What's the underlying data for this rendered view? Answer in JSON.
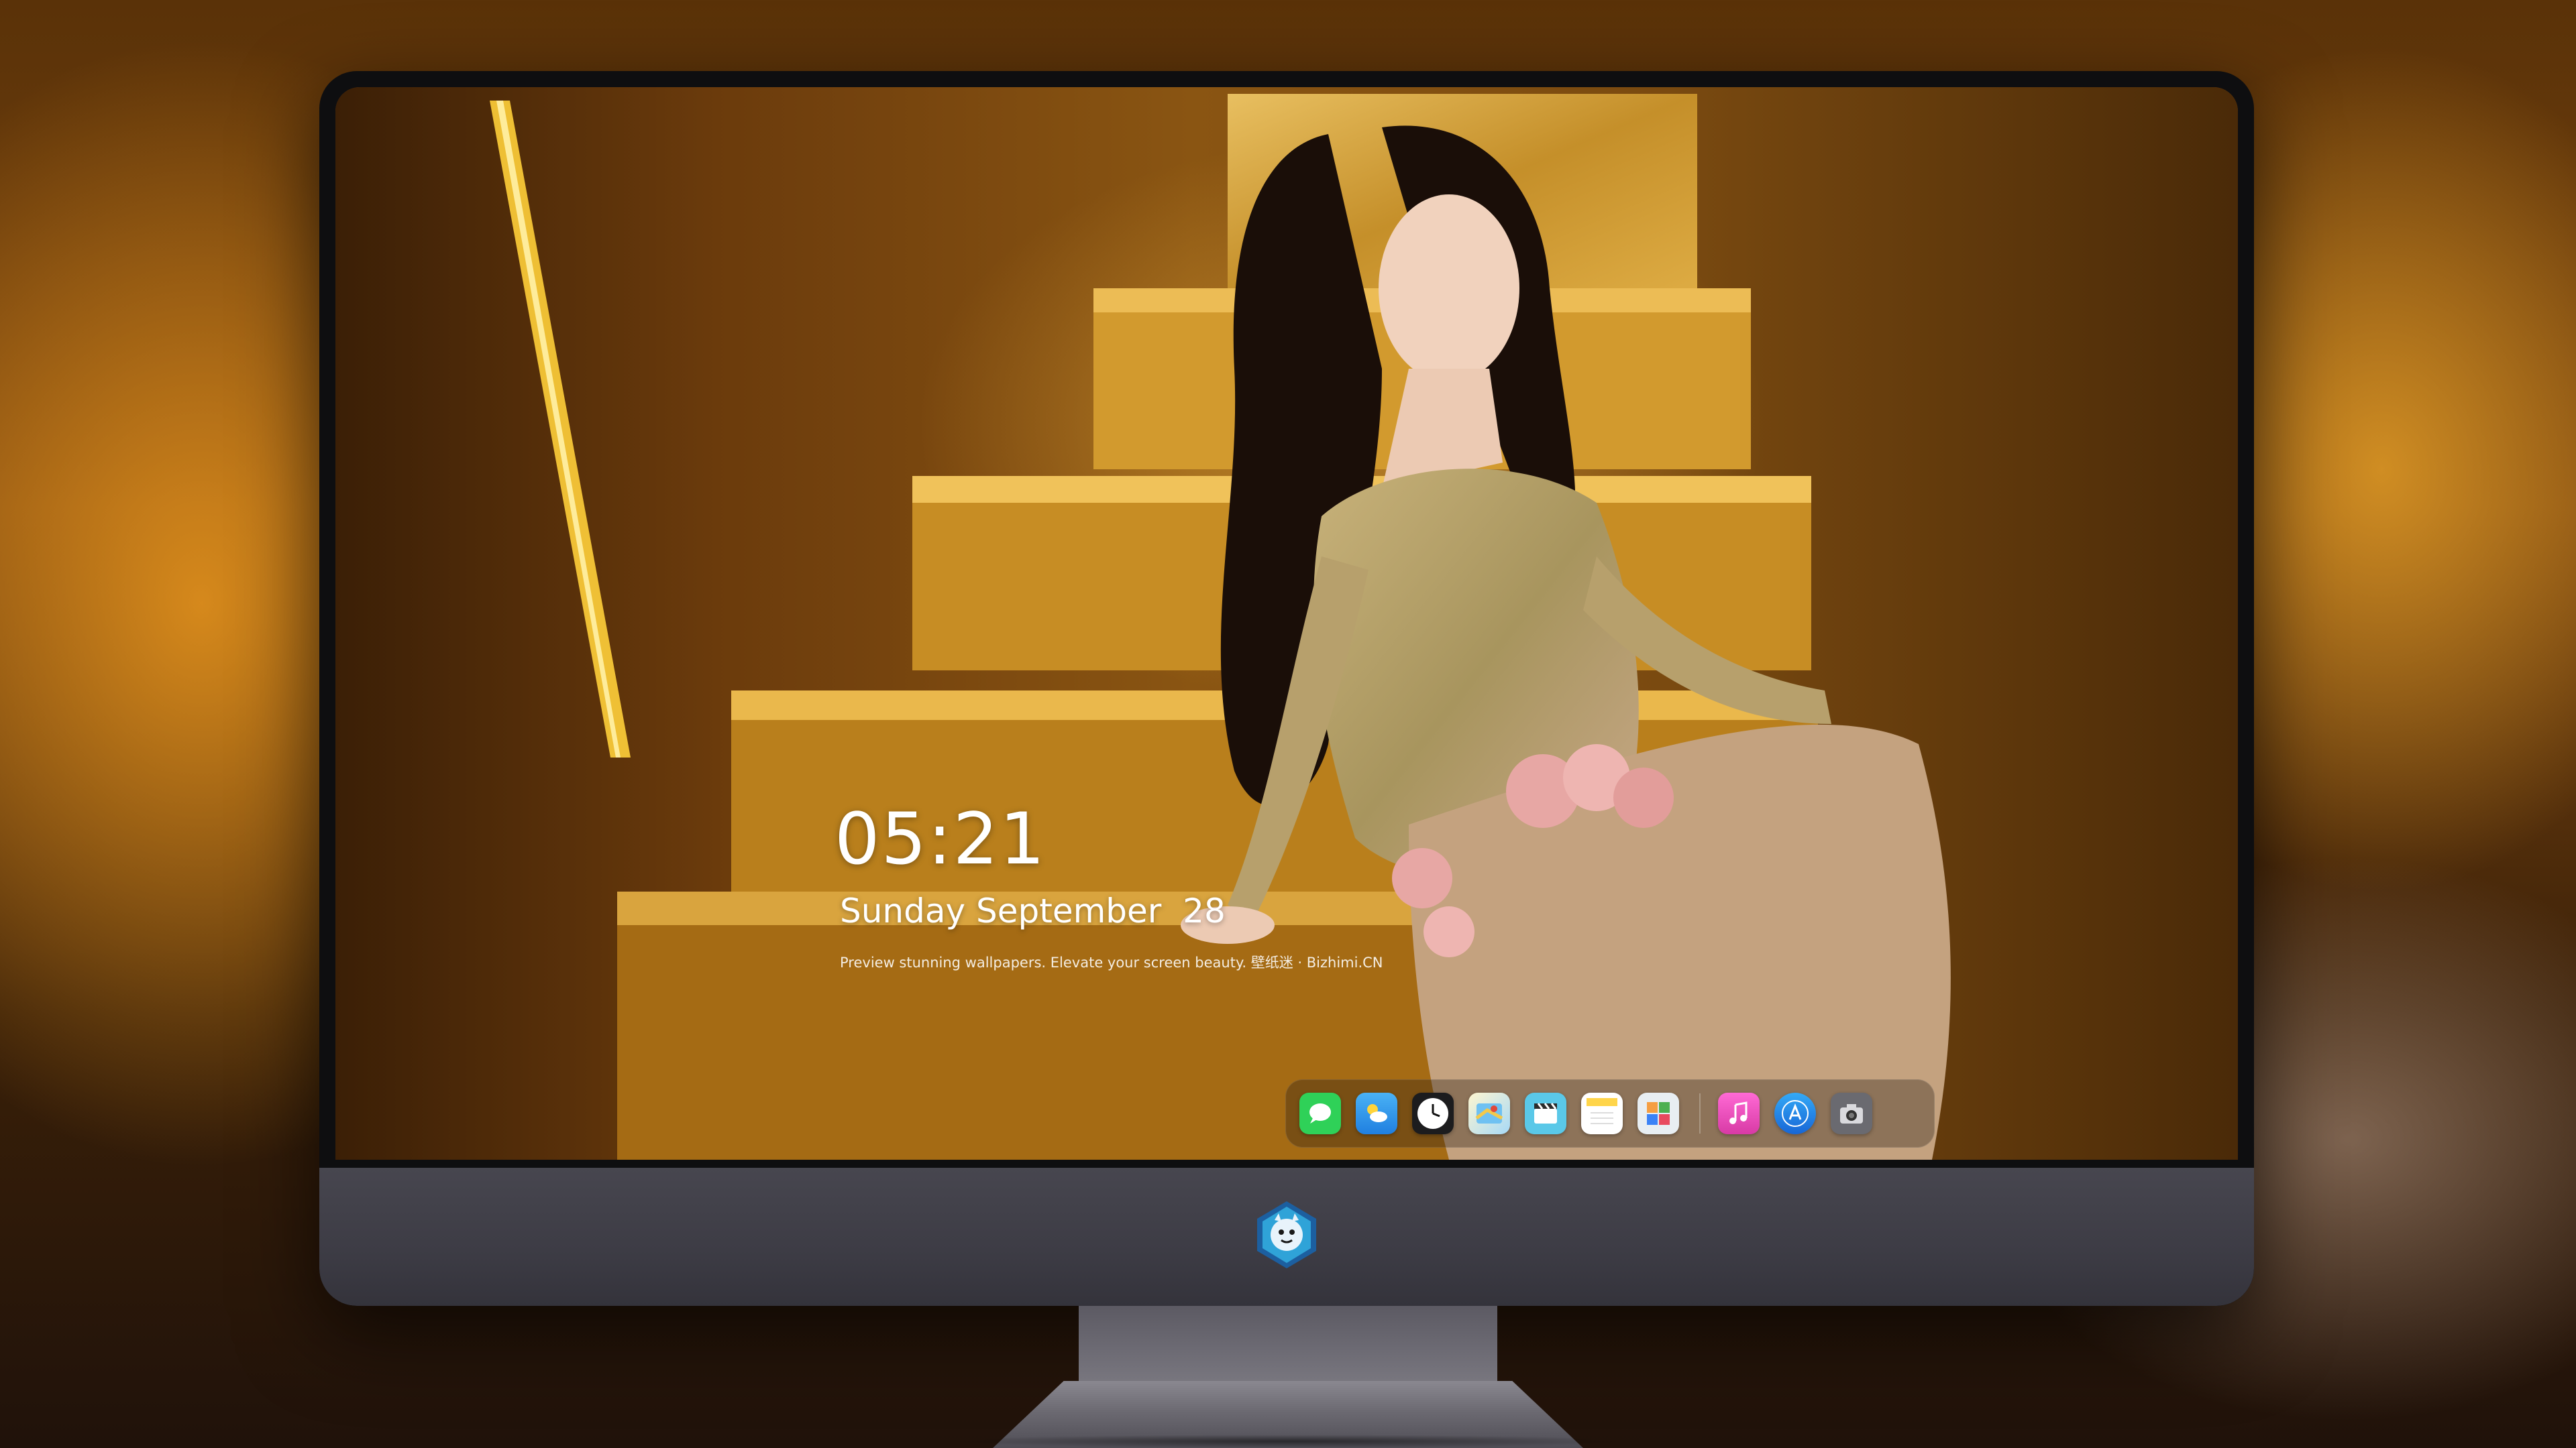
{
  "lockscreen": {
    "time": "05:21",
    "date": "Sunday September  28",
    "tagline": "Preview stunning wallpapers. Elevate your screen beauty. 壁纸迷 · Bizhimi.CN"
  },
  "dock": {
    "apps": [
      {
        "name": "messages",
        "icon": "messages-icon",
        "color": "#2fd158"
      },
      {
        "name": "weather",
        "icon": "weather-icon",
        "color": "#3aa0f0"
      },
      {
        "name": "clock",
        "icon": "clock-icon",
        "color": "#1c1c1e"
      },
      {
        "name": "maps",
        "icon": "maps-icon",
        "color": "#f2c94c"
      },
      {
        "name": "clips",
        "icon": "clapperboard-icon",
        "color": "#5ac8e8"
      },
      {
        "name": "notes",
        "icon": "notes-icon",
        "color": "#ffd54a"
      },
      {
        "name": "photos-gallery",
        "icon": "gallery-icon",
        "color": "#e8eef2"
      },
      {
        "name": "music",
        "icon": "music-icon",
        "color": "#f05adb"
      },
      {
        "name": "app-store",
        "icon": "app-store-icon",
        "color": "#1d8ef0"
      },
      {
        "name": "camera",
        "icon": "camera-icon",
        "color": "#6a6a70"
      }
    ]
  },
  "monitor": {
    "chin_logo": "mascot-logo-icon"
  }
}
